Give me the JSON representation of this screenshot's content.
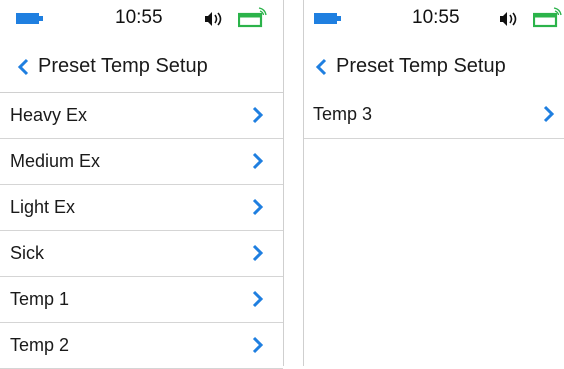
{
  "screens": [
    {
      "status": {
        "time": "10:55",
        "icons": [
          "battery-icon",
          "sound-icon",
          "pump-battery-icon"
        ]
      },
      "nav": {
        "back_icon": "chevron-left-icon",
        "title": "Preset Temp Setup"
      },
      "items": [
        {
          "label": "Heavy Ex"
        },
        {
          "label": "Medium Ex"
        },
        {
          "label": "Light Ex"
        },
        {
          "label": "Sick"
        },
        {
          "label": "Temp 1"
        },
        {
          "label": "Temp 2"
        }
      ]
    },
    {
      "status": {
        "time": "10:55",
        "icons": [
          "battery-icon",
          "sound-icon",
          "pump-battery-icon"
        ]
      },
      "nav": {
        "back_icon": "chevron-left-icon",
        "title": "Preset Temp Setup"
      },
      "items": [
        {
          "label": "Temp 3"
        }
      ]
    }
  ],
  "colors": {
    "accent": "#1f7fe0",
    "pump_battery": "#2bb34a",
    "divider": "#d5d5d5"
  }
}
